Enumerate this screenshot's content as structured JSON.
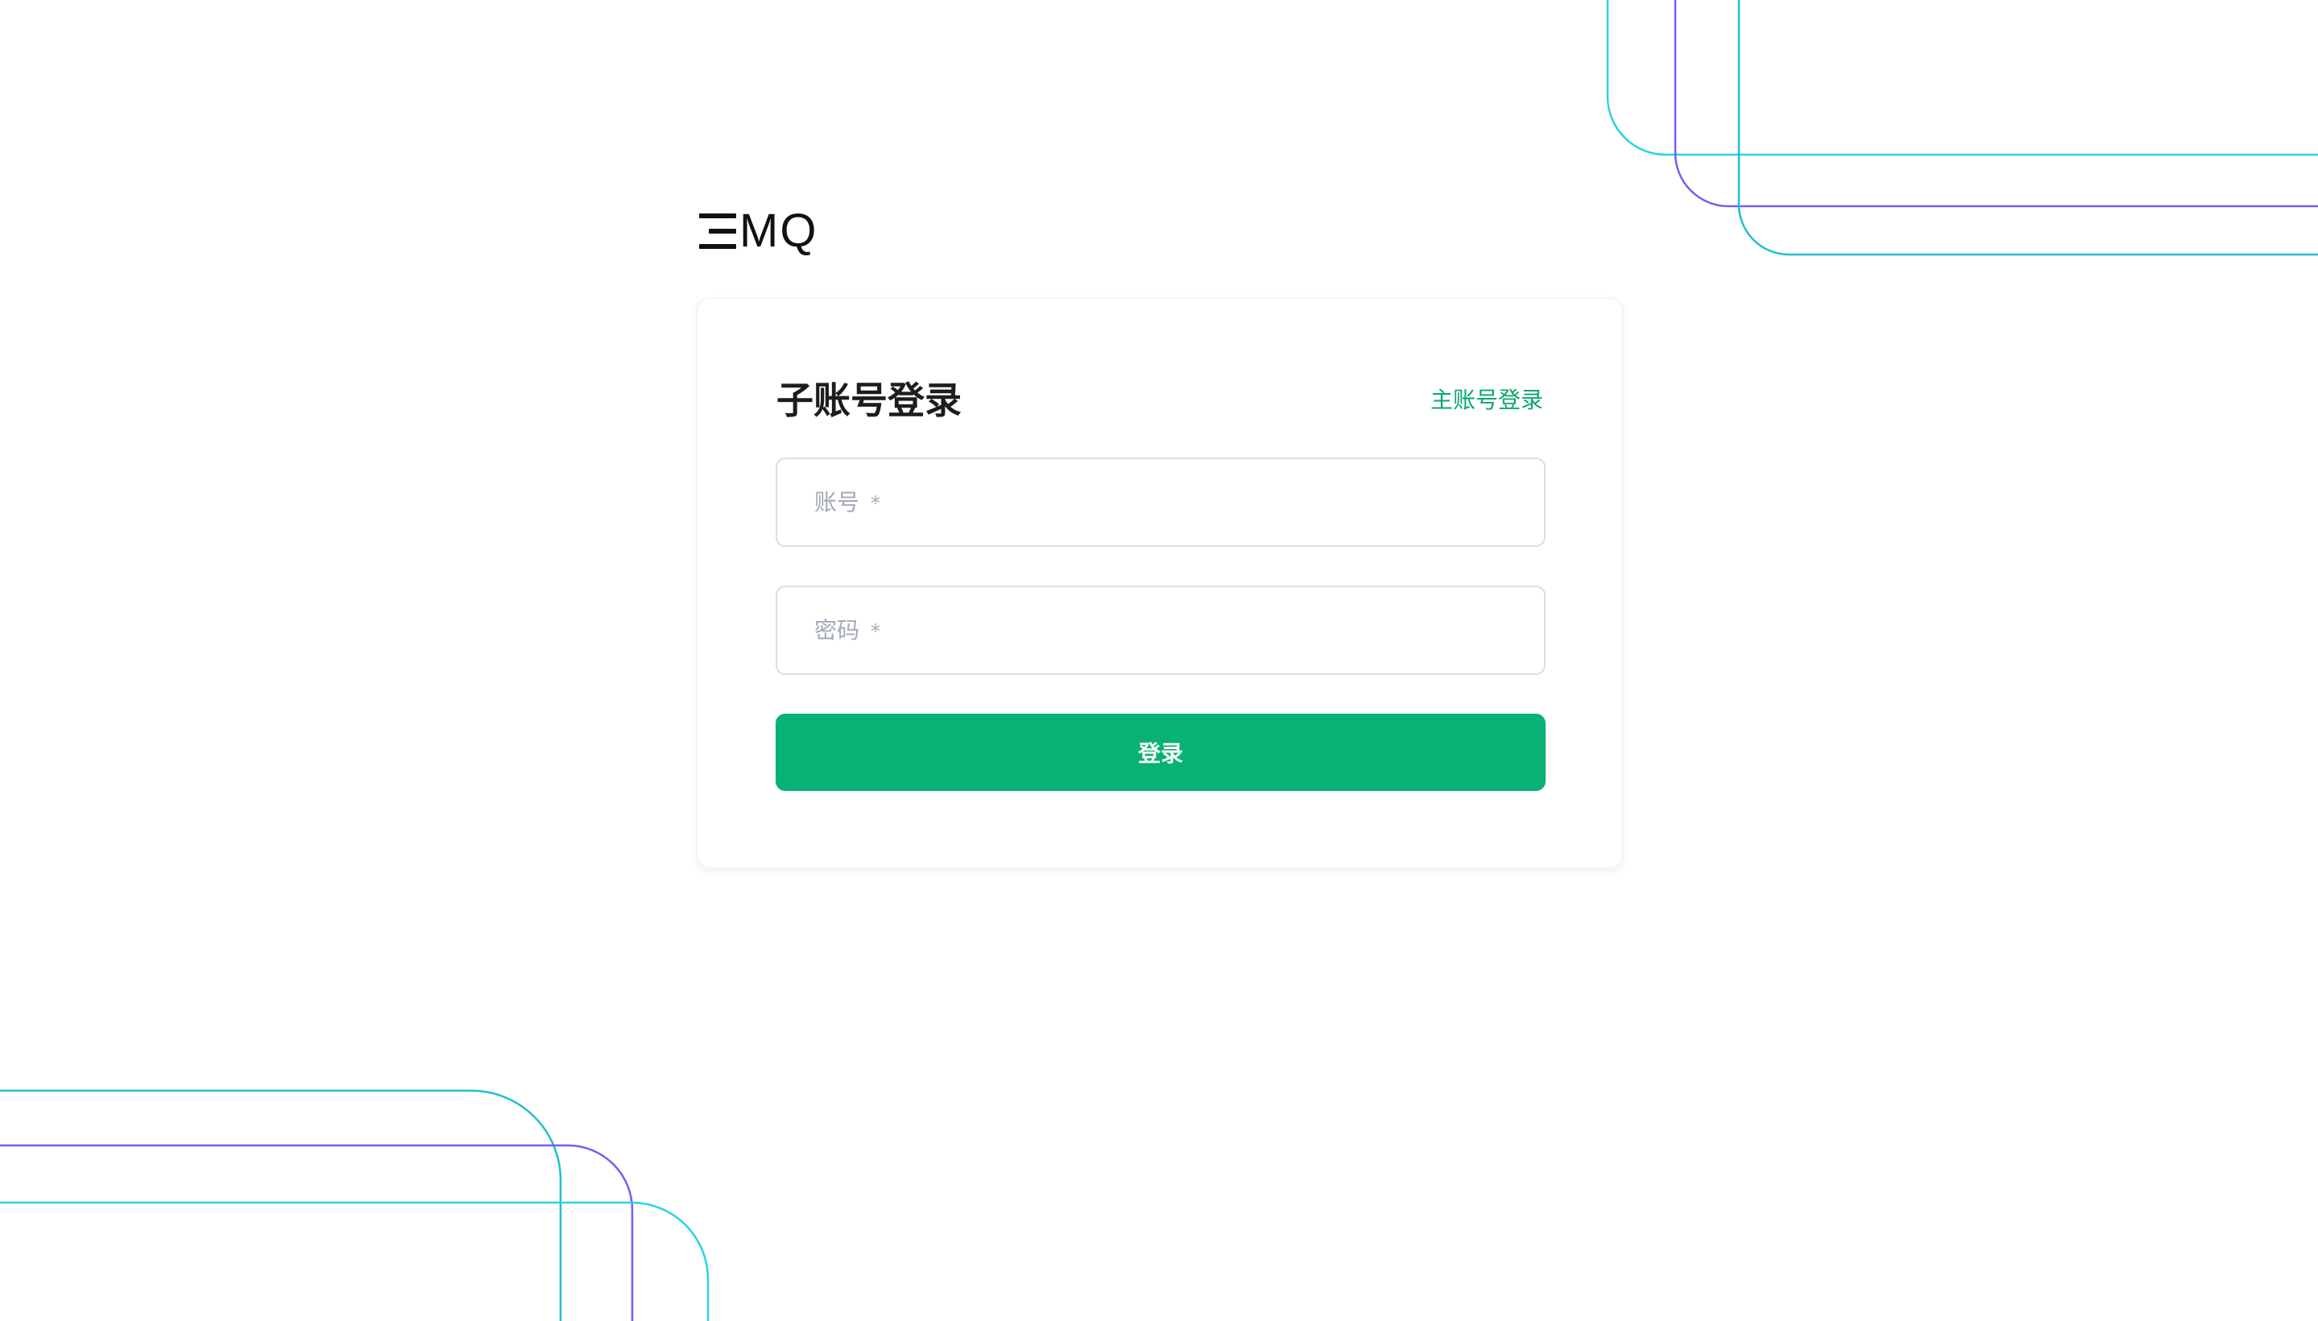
{
  "brand": {
    "logo_text": "MQ",
    "logo_mark": "three-horizontal-bars (stylized E)"
  },
  "login": {
    "title": "子账号登录",
    "switch_link": "主账号登录",
    "account": {
      "label": "账号",
      "required_mark": "*",
      "value": ""
    },
    "password": {
      "label": "密码",
      "required_mark": "*",
      "value": ""
    },
    "submit_label": "登录"
  },
  "colors": {
    "accent": "#08b174",
    "link": "#0aa76a",
    "deco_teal": "#1fbfd0",
    "deco_cyan": "#2ad3e6",
    "deco_purple": "#7a5cf0"
  }
}
